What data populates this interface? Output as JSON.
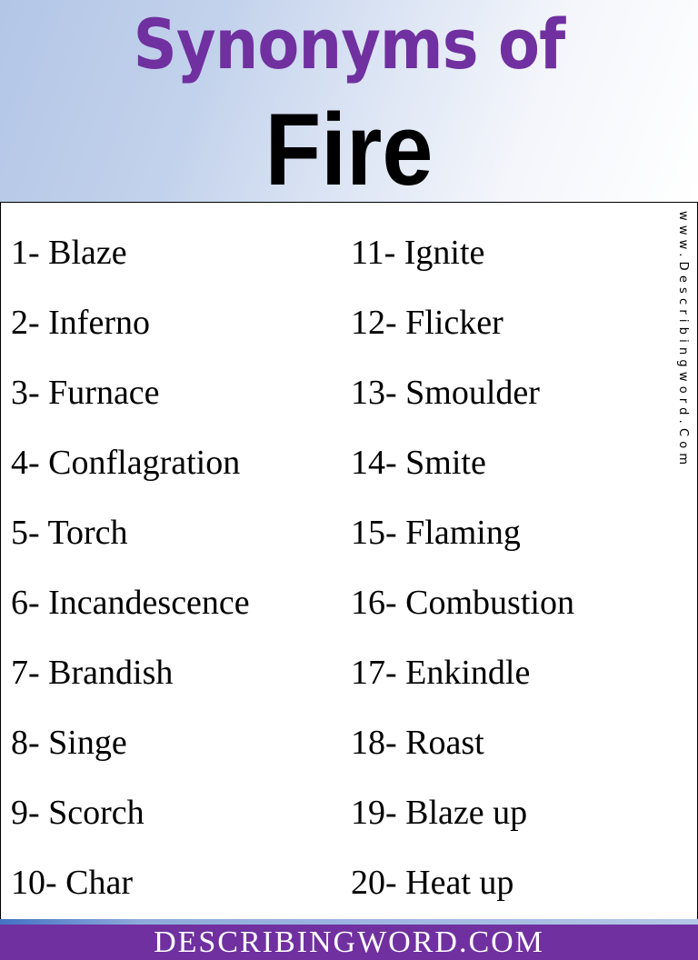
{
  "header": {
    "title_line1": "Synonyms of",
    "title_line2": "Fire",
    "colors": {
      "title_line1": "#7030a0",
      "title_line2": "#000000"
    }
  },
  "list": {
    "left": [
      "1- Blaze",
      "2- Inferno",
      "3- Furnace",
      "4- Conflagration",
      "5- Torch",
      "6- Incandescence",
      "7- Brandish",
      "8- Singe",
      "9- Scorch",
      "10- Char"
    ],
    "right": [
      "11- Ignite",
      "12- Flicker",
      "13- Smoulder",
      "14- Smite",
      "15- Flaming",
      "16- Combustion",
      "17- Enkindle",
      "18- Roast",
      "19- Blaze up",
      "20- Heat up"
    ]
  },
  "watermark": "www.Describingword.Com",
  "footer": {
    "text": "DESCRIBINGWORD.COM",
    "color": "#7030a0"
  }
}
